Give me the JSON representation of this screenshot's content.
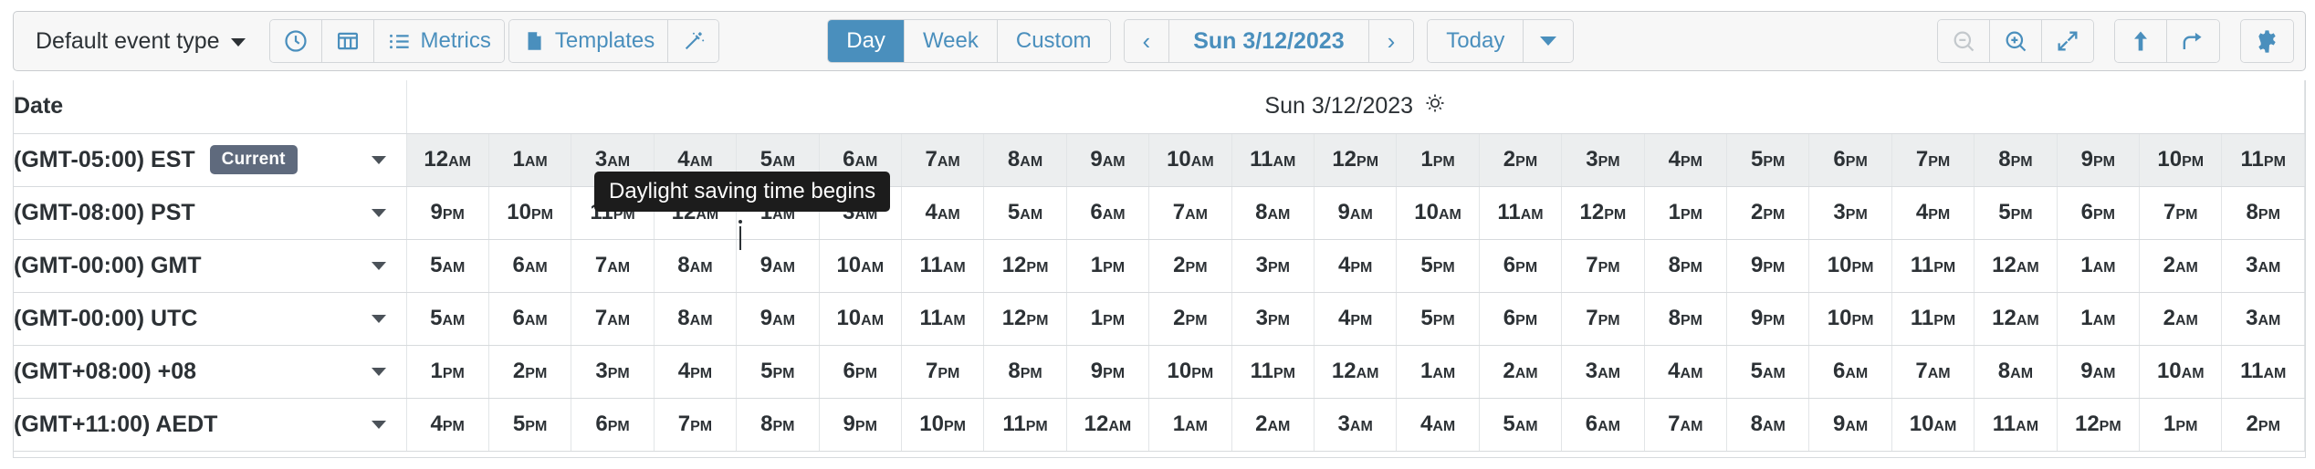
{
  "toolbar": {
    "event_type_label": "Default event type",
    "clock_icon": "clock-icon",
    "columns_icon": "columns-icon",
    "metrics_label": "Metrics",
    "metrics_icon": "list-icon",
    "templates_label": "Templates",
    "templates_icon": "book-icon",
    "wand_icon": "magic-wand-icon",
    "view_modes": [
      {
        "label": "Day",
        "active": true
      },
      {
        "label": "Week",
        "active": false
      },
      {
        "label": "Custom",
        "active": false
      }
    ],
    "prev_label": "‹",
    "date_label": "Sun 3/12/2023",
    "next_label": "›",
    "today_label": "Today",
    "right_icons": [
      {
        "name": "zoom-out-icon",
        "disabled": true
      },
      {
        "name": "zoom-in-icon",
        "disabled": false
      },
      {
        "name": "expand-icon",
        "disabled": false
      },
      {
        "name": "upload-icon",
        "disabled": false
      },
      {
        "name": "share-icon",
        "disabled": false
      },
      {
        "name": "settings-gear-icon",
        "disabled": false
      }
    ],
    "accent_color": "#4a8fbd",
    "active_bg": "#4a8fbd"
  },
  "tooltip": {
    "text": "Daylight saving time begins"
  },
  "table": {
    "date_header": "Date",
    "right_header": "Sun 3/12/2023",
    "sun_icon": "sun-icon",
    "rows": [
      {
        "zone": "(GMT-05:00) EST",
        "badge": "Current",
        "shaded": true,
        "hours": [
          "12AM",
          "1AM",
          "3AM",
          "4AM",
          "5AM",
          "6AM",
          "7AM",
          "8AM",
          "9AM",
          "10AM",
          "11AM",
          "12PM",
          "1PM",
          "2PM",
          "3PM",
          "4PM",
          "5PM",
          "6PM",
          "7PM",
          "8PM",
          "9PM",
          "10PM",
          "11PM"
        ]
      },
      {
        "zone": "(GMT-08:00) PST",
        "badge": "",
        "shaded": false,
        "hours": [
          "9PM",
          "10PM",
          "11PM",
          "12AM",
          "1AM",
          "3AM",
          "4AM",
          "5AM",
          "6AM",
          "7AM",
          "8AM",
          "9AM",
          "10AM",
          "11AM",
          "12PM",
          "1PM",
          "2PM",
          "3PM",
          "4PM",
          "5PM",
          "6PM",
          "7PM",
          "8PM"
        ]
      },
      {
        "zone": "(GMT-00:00) GMT",
        "badge": "",
        "shaded": false,
        "hours": [
          "5AM",
          "6AM",
          "7AM",
          "8AM",
          "9AM",
          "10AM",
          "11AM",
          "12PM",
          "1PM",
          "2PM",
          "3PM",
          "4PM",
          "5PM",
          "6PM",
          "7PM",
          "8PM",
          "9PM",
          "10PM",
          "11PM",
          "12AM",
          "1AM",
          "2AM",
          "3AM"
        ]
      },
      {
        "zone": "(GMT-00:00) UTC",
        "badge": "",
        "shaded": false,
        "hours": [
          "5AM",
          "6AM",
          "7AM",
          "8AM",
          "9AM",
          "10AM",
          "11AM",
          "12PM",
          "1PM",
          "2PM",
          "3PM",
          "4PM",
          "5PM",
          "6PM",
          "7PM",
          "8PM",
          "9PM",
          "10PM",
          "11PM",
          "12AM",
          "1AM",
          "2AM",
          "3AM"
        ]
      },
      {
        "zone": "(GMT+08:00) +08",
        "badge": "",
        "shaded": false,
        "hours": [
          "1PM",
          "2PM",
          "3PM",
          "4PM",
          "5PM",
          "6PM",
          "7PM",
          "8PM",
          "9PM",
          "10PM",
          "11PM",
          "12AM",
          "1AM",
          "2AM",
          "3AM",
          "4AM",
          "5AM",
          "6AM",
          "7AM",
          "8AM",
          "9AM",
          "10AM",
          "11AM"
        ]
      },
      {
        "zone": "(GMT+11:00) AEDT",
        "badge": "",
        "shaded": false,
        "hours": [
          "4PM",
          "5PM",
          "6PM",
          "7PM",
          "8PM",
          "9PM",
          "10PM",
          "11PM",
          "12AM",
          "1AM",
          "2AM",
          "3AM",
          "4AM",
          "5AM",
          "6AM",
          "7AM",
          "8AM",
          "9AM",
          "10AM",
          "11AM",
          "12PM",
          "1PM",
          "2PM"
        ]
      }
    ]
  }
}
